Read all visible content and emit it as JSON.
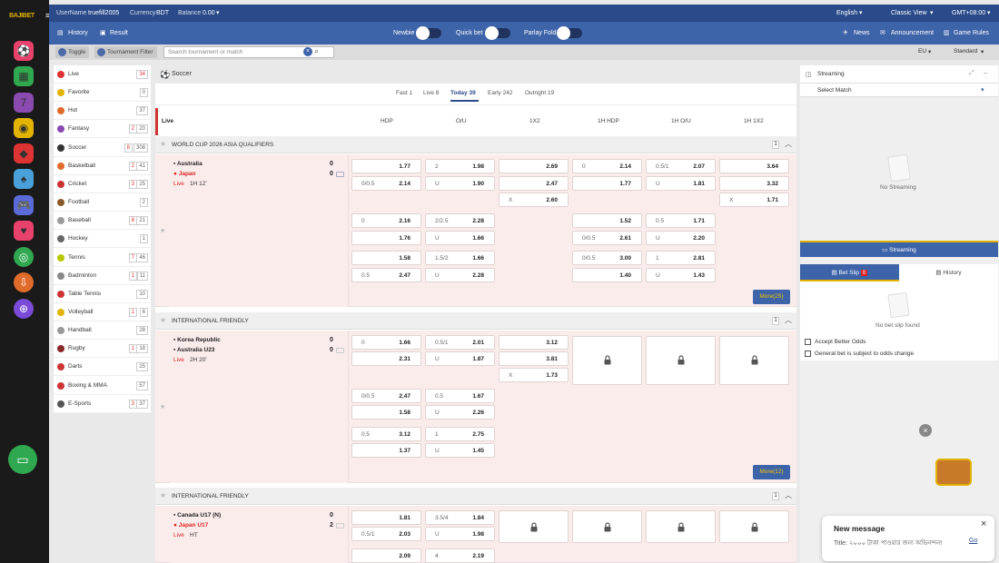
{
  "brand": {
    "logo": "BAJIBET"
  },
  "topbar": {
    "username_label": "UserName",
    "username": "truefill2005",
    "currency_label": "Currency",
    "currency": "BDT",
    "balance_label": "Balance",
    "balance": "0.00",
    "language": "English",
    "view": "Classic View",
    "timezone": "GMT+08:00"
  },
  "subbar": {
    "history": "History",
    "result": "Result",
    "newbie": "Newbie",
    "quick_bet": "Quick bet",
    "parlay_fold": "Parlay Fold",
    "news": "News",
    "announcement": "Announcement",
    "game_rules": "Game Rules"
  },
  "filterbar": {
    "toggle": "Toggle",
    "tournament_filter": "Tournament Filter",
    "search_placeholder": "Search tournament or match",
    "odds_type": "EU",
    "display": "Standard"
  },
  "sidebar": [
    {
      "label": "Live",
      "live": "",
      "count": "34",
      "color": "#d33",
      "count_red": true
    },
    {
      "label": "Favorite",
      "live": "",
      "count": "0",
      "color": "#e2b300"
    },
    {
      "label": "Hot",
      "live": "",
      "count": "37",
      "color": "#e06b2a"
    },
    {
      "label": "Fantasy",
      "live": "2",
      "count": "20",
      "color": "#8a4ab0"
    },
    {
      "label": "Soccer",
      "live": "8",
      "count": "308",
      "color": "#333"
    },
    {
      "label": "Basketball",
      "live": "2",
      "count": "41",
      "color": "#e06b2a"
    },
    {
      "label": "Cricket",
      "live": "3",
      "count": "25",
      "color": "#c33"
    },
    {
      "label": "Football",
      "live": "",
      "count": "2",
      "color": "#8a5a2a"
    },
    {
      "label": "Baseball",
      "live": "8",
      "count": "21",
      "color": "#999"
    },
    {
      "label": "Hockey",
      "live": "",
      "count": "1",
      "color": "#666"
    },
    {
      "label": "Tennis",
      "live": "7",
      "count": "46",
      "color": "#b6c800"
    },
    {
      "label": "Badminton",
      "live": "1",
      "count": "11",
      "color": "#888"
    },
    {
      "label": "Table Tennis",
      "live": "",
      "count": "10",
      "color": "#c33"
    },
    {
      "label": "Volleyball",
      "live": "1",
      "count": "6",
      "color": "#e2b300"
    },
    {
      "label": "Handball",
      "live": "",
      "count": "28",
      "color": "#999"
    },
    {
      "label": "Rugby",
      "live": "1",
      "count": "18",
      "color": "#8a2a2a"
    },
    {
      "label": "Darts",
      "live": "",
      "count": "25",
      "color": "#c33"
    },
    {
      "label": "Boxing & MMA",
      "live": "",
      "count": "57",
      "color": "#c33"
    },
    {
      "label": "E-Sports",
      "live": "3",
      "count": "37",
      "color": "#555"
    }
  ],
  "main": {
    "sport_title": "Soccer",
    "tabs": [
      "Fast 1",
      "Live 8",
      "Today 39",
      "Early 242",
      "Outright 19"
    ],
    "active_tab": "Today 39",
    "columns": [
      "Live",
      "HDP",
      "O/U",
      "1X2",
      "1H HDP",
      "1H O/U",
      "1H 1X2"
    ]
  },
  "leagues": [
    {
      "name": "WORLD CUP 2026 ASIA QUALIFIERS",
      "count": "1",
      "home": "Australia",
      "away": "Japan",
      "home_score": "0",
      "away_score": "0",
      "live": "Live",
      "time": "1H 12'",
      "more": "More",
      "more_count": "(25)"
    },
    {
      "name": "INTERNATIONAL FRIENDLY",
      "count": "1",
      "home": "Korea Republic",
      "away": "Australia U23",
      "home_score": "0",
      "away_score": "0",
      "live": "Live",
      "time": "2H 20'",
      "more": "More",
      "more_count": "(12)"
    },
    {
      "name": "INTERNATIONAL FRIENDLY",
      "count": "1",
      "home": "Canada U17 (N)",
      "away": "Japan U17",
      "home_score": "0",
      "away_score": "2",
      "live": "Live",
      "time": "HT"
    }
  ],
  "odds1": {
    "r1": [
      [
        "",
        "1.77"
      ],
      [
        "2",
        "1.98"
      ],
      [
        "",
        "2.69"
      ],
      [
        "0",
        "2.14"
      ],
      [
        "0.5/1",
        "2.07"
      ],
      [
        "",
        "3.64"
      ]
    ],
    "r2": [
      [
        "0/0.5",
        "2.14"
      ],
      [
        "U",
        "1.90"
      ],
      [
        "",
        "2.47"
      ],
      [
        "",
        "1.77"
      ],
      [
        "U",
        "1.81"
      ],
      [
        "",
        "3.32"
      ]
    ],
    "r3": [
      [
        "X",
        "2.60"
      ],
      [
        "X",
        "1.71"
      ]
    ],
    "r4": [
      [
        "0",
        "2.16"
      ],
      [
        "2/2.5",
        "2.28"
      ],
      [
        "",
        "1.52"
      ],
      [
        "0.5",
        "1.71"
      ]
    ],
    "r5": [
      [
        "",
        "1.76"
      ],
      [
        "U",
        "1.66"
      ],
      [
        "0/0.5",
        "2.61"
      ],
      [
        "U",
        "2.20"
      ]
    ],
    "r6": [
      [
        "",
        "1.58"
      ],
      [
        "1.5/2",
        "1.66"
      ],
      [
        "0/0.5",
        "3.00"
      ],
      [
        "1",
        "2.81"
      ]
    ],
    "r7": [
      [
        "0.5",
        "2.47"
      ],
      [
        "U",
        "2.28"
      ],
      [
        "",
        "1.40"
      ],
      [
        "U",
        "1.43"
      ]
    ]
  },
  "odds2": {
    "r1": [
      [
        "0",
        "1.66"
      ],
      [
        "0.5/1",
        "2.01"
      ],
      [
        "",
        "3.12"
      ]
    ],
    "r2": [
      [
        "",
        "2.31"
      ],
      [
        "U",
        "1.87"
      ],
      [
        "",
        "3.81"
      ]
    ],
    "r3": [
      [
        "X",
        "1.73"
      ]
    ],
    "r4": [
      [
        "0/0.5",
        "2.47"
      ],
      [
        "0.5",
        "1.67"
      ]
    ],
    "r5": [
      [
        "",
        "1.58"
      ],
      [
        "U",
        "2.26"
      ]
    ],
    "r6": [
      [
        "0.5",
        "3.12"
      ],
      [
        "1",
        "2.75"
      ]
    ],
    "r7": [
      [
        "",
        "1.37"
      ],
      [
        "U",
        "1.45"
      ]
    ]
  },
  "odds3": {
    "r1": [
      [
        "",
        "1.81"
      ],
      [
        "3.5/4",
        "1.84"
      ]
    ],
    "r2": [
      [
        "0.5/1",
        "2.03"
      ],
      [
        "U",
        "1.98"
      ]
    ],
    "r3": [
      [
        "",
        "2.09"
      ],
      [
        "4",
        "2.19"
      ]
    ]
  },
  "right": {
    "streaming": "Streaming",
    "select_match": "Select Match",
    "no_streaming": "No Streaming",
    "streaming_btn": "Streaming",
    "bet_slip": "Bet Slip",
    "bet_count": "0",
    "history": "History",
    "no_bet": "No bet slip found",
    "accept_odds": "Accept Better Odds",
    "general_bet": "General bet is subject to odds change"
  },
  "toast": {
    "title": "New message",
    "body": "Title: ২০০০ টাকা পাওয়ার জন্য অভিনন্দন!",
    "link": "Go"
  }
}
